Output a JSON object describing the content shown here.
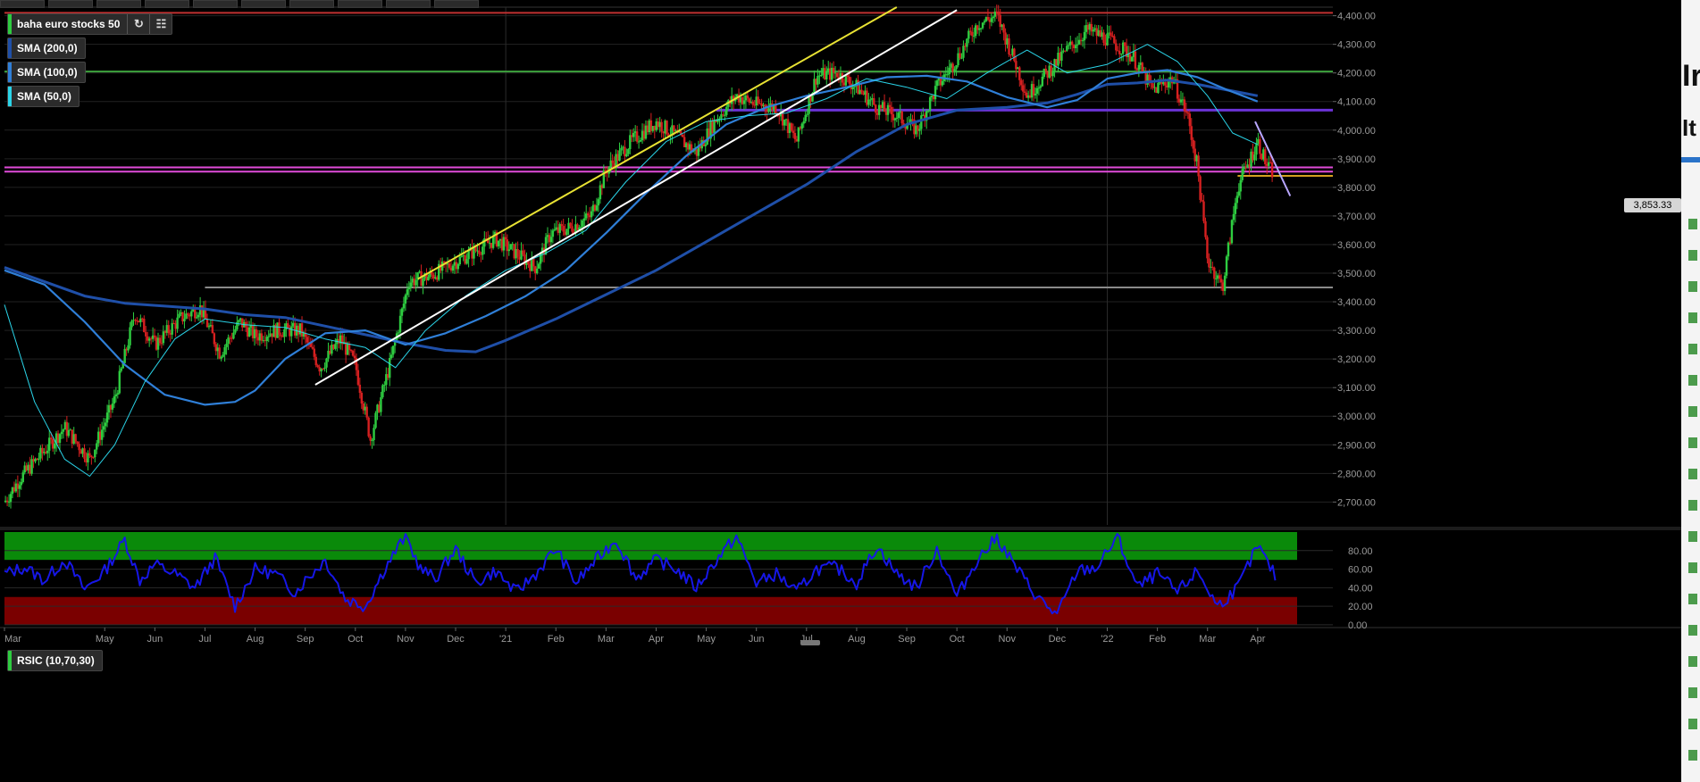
{
  "chart_data": {
    "type": "candlestick",
    "instrument": "baha euro stocks 50",
    "last_price_label": "3,853.33",
    "price_axis": {
      "ticks": [
        2700,
        2800,
        2900,
        3000,
        3100,
        3200,
        3300,
        3400,
        3500,
        3600,
        3700,
        3800,
        3900,
        4000,
        4100,
        4200,
        4300,
        4400
      ],
      "tick_labels": [
        "2,700.00",
        "2,800.00",
        "2,900.00",
        "3,000.00",
        "3,100.00",
        "3,200.00",
        "3,300.00",
        "3,400.00",
        "3,500.00",
        "3,600.00",
        "3,700.00",
        "3,800.00",
        "3,900.00",
        "4,000.00",
        "4,100.00",
        "4,200.00",
        "4,300.00",
        "4,400.00"
      ],
      "range": [
        2620,
        4430
      ]
    },
    "time_axis": {
      "labels": [
        "Mar",
        "May",
        "Jun",
        "Jul",
        "Aug",
        "Sep",
        "Oct",
        "Nov",
        "Dec",
        "'21",
        "Feb",
        "Mar",
        "Apr",
        "May",
        "Jun",
        "Jul",
        "Aug",
        "Sep",
        "Oct",
        "Nov",
        "Dec",
        "'22",
        "Feb",
        "Mar",
        "Apr"
      ],
      "label_month_index": [
        0,
        2,
        3,
        4,
        5,
        6,
        7,
        8,
        9,
        10,
        11,
        12,
        13,
        14,
        15,
        16,
        17,
        18,
        19,
        20,
        21,
        22,
        23,
        24,
        25
      ],
      "range_months": [
        0,
        26.5
      ]
    },
    "price_path": {
      "month_index": [
        0,
        0.3,
        0.8,
        1.2,
        1.7,
        2.2,
        2.6,
        3.0,
        3.5,
        3.9,
        4.3,
        4.7,
        5.0,
        5.4,
        5.9,
        6.3,
        6.7,
        7.0,
        7.3,
        7.7,
        8.0,
        8.05,
        8.5,
        9.0,
        9.4,
        9.8,
        10.2,
        10.6,
        10.9,
        11.3,
        11.7,
        12.0,
        12.5,
        13.0,
        13.4,
        13.8,
        14.2,
        14.6,
        15.0,
        15.4,
        15.8,
        16.2,
        16.6,
        17.0,
        17.4,
        17.8,
        18.2,
        18.6,
        19.0,
        19.4,
        19.8,
        20.2,
        20.4,
        20.8,
        21.2,
        21.6,
        22.0,
        22.5,
        22.9,
        23.3,
        23.6,
        23.8,
        24.0,
        24.3,
        24.6,
        24.8,
        25.0,
        25.2,
        25.3
      ],
      "close": [
        2700,
        2780,
        2880,
        2960,
        2850,
        3060,
        3360,
        3250,
        3340,
        3380,
        3220,
        3330,
        3280,
        3300,
        3300,
        3170,
        3270,
        3180,
        2920,
        3190,
        3420,
        3470,
        3490,
        3540,
        3580,
        3620,
        3570,
        3520,
        3640,
        3660,
        3700,
        3860,
        3960,
        4030,
        3980,
        3920,
        4040,
        4120,
        4090,
        4080,
        3960,
        4190,
        4200,
        4150,
        4080,
        4050,
        4000,
        4150,
        4250,
        4370,
        4400,
        4220,
        4120,
        4200,
        4280,
        4350,
        4320,
        4260,
        4140,
        4180,
        4050,
        3870,
        3550,
        3450,
        3800,
        3880,
        3960,
        3870,
        3853
      ]
    },
    "series": [
      {
        "name": "SMA (200,0)",
        "color": "#1f4fa8",
        "x": [
          0,
          0.8,
          1.6,
          2.4,
          3.2,
          4.0,
          4.8,
          5.6,
          6.4,
          7.2,
          8.0,
          8.8,
          9.4,
          10.0,
          11.0,
          12.0,
          13.0,
          14.0,
          15.0,
          16.0,
          17.0,
          18.0,
          19.0,
          20.0,
          20.8,
          21.4,
          22.0,
          22.6,
          23.2,
          23.8,
          24.4,
          25.0
        ],
        "y": [
          3520,
          3470,
          3420,
          3395,
          3385,
          3375,
          3355,
          3345,
          3315,
          3285,
          3255,
          3230,
          3225,
          3265,
          3340,
          3425,
          3510,
          3610,
          3710,
          3810,
          3925,
          4020,
          4070,
          4080,
          4095,
          4125,
          4160,
          4165,
          4175,
          4160,
          4140,
          4120
        ]
      },
      {
        "name": "SMA (100,0)",
        "color": "#2f7fd8",
        "x": [
          0,
          0.8,
          1.6,
          2.4,
          3.2,
          4.0,
          4.6,
          5.0,
          5.6,
          6.4,
          7.2,
          8.0,
          8.8,
          9.6,
          10.4,
          11.2,
          12.0,
          12.8,
          13.6,
          14.4,
          15.2,
          16.0,
          16.8,
          17.6,
          18.4,
          19.2,
          20.0,
          20.8,
          21.4,
          22.0,
          22.6,
          23.2,
          23.8,
          24.4,
          25.0
        ],
        "y": [
          3510,
          3460,
          3330,
          3180,
          3075,
          3040,
          3050,
          3090,
          3200,
          3290,
          3300,
          3250,
          3290,
          3350,
          3420,
          3510,
          3640,
          3780,
          3910,
          4020,
          4080,
          4120,
          4150,
          4185,
          4190,
          4170,
          4115,
          4080,
          4105,
          4180,
          4200,
          4210,
          4185,
          4140,
          4100
        ]
      },
      {
        "name": "SMA (50,0)",
        "color": "#2ad4e8",
        "x": [
          0,
          0.6,
          1.2,
          1.7,
          2.2,
          2.8,
          3.4,
          4.0,
          4.8,
          5.6,
          6.4,
          7.2,
          7.8,
          8.4,
          9.2,
          10.0,
          10.8,
          11.6,
          12.4,
          13.2,
          14.0,
          14.8,
          15.6,
          16.4,
          17.2,
          18.0,
          18.8,
          19.6,
          20.4,
          21.2,
          22.0,
          22.8,
          23.4,
          24.0,
          24.5,
          25.0
        ],
        "y": [
          3390,
          3050,
          2850,
          2790,
          2900,
          3120,
          3270,
          3340,
          3320,
          3310,
          3270,
          3240,
          3170,
          3300,
          3420,
          3510,
          3570,
          3650,
          3820,
          3960,
          4030,
          4050,
          4060,
          4110,
          4180,
          4150,
          4110,
          4200,
          4280,
          4200,
          4230,
          4300,
          4240,
          4120,
          3990,
          3950
        ]
      }
    ],
    "trend_lines": [
      {
        "color": "#e8e233",
        "x": [
          8.25,
          17.8
        ],
        "y": [
          3480,
          4430
        ]
      },
      {
        "color": "#ffffff",
        "x": [
          6.2,
          19.0
        ],
        "y": [
          3110,
          4420
        ]
      },
      {
        "color": "#b9a7ff",
        "x": [
          24.95,
          25.65
        ],
        "y": [
          4030,
          3770
        ]
      }
    ],
    "horizontal_lines": [
      {
        "y": 4410,
        "color": "#c03030"
      },
      {
        "y": 4205,
        "color": "#3ea33e"
      },
      {
        "y": 4070,
        "color": "#6b33d6",
        "from_month": 14.2
      },
      {
        "y": 3870,
        "color": "#e04bd9"
      },
      {
        "y": 3855,
        "color": "#e04bd9"
      },
      {
        "y": 3840,
        "color": "#d4a020",
        "from_month": 24.6
      },
      {
        "y": 3450,
        "color": "#8a8a8a",
        "from_month": 4.0
      }
    ],
    "rsi": {
      "name": "RSIC (10,70,30)",
      "color": "#1616e6",
      "overbought": 70,
      "oversold": 30,
      "ticks": [
        0,
        20,
        40,
        60,
        80
      ],
      "tick_labels": [
        "0.00",
        "20.00",
        "40.00",
        "60.00",
        "80.00"
      ],
      "range": [
        -2,
        100
      ],
      "x": [
        0,
        0.4,
        0.8,
        1.2,
        1.6,
        2.0,
        2.4,
        2.7,
        3.0,
        3.4,
        3.8,
        4.2,
        4.6,
        5.0,
        5.4,
        5.8,
        6.0,
        6.4,
        6.8,
        7.2,
        7.6,
        8.0,
        8.3,
        8.6,
        9.0,
        9.4,
        9.8,
        10.2,
        10.6,
        11.0,
        11.4,
        11.8,
        12.2,
        12.6,
        13.0,
        13.4,
        13.8,
        14.2,
        14.6,
        15.0,
        15.4,
        15.8,
        16.2,
        16.6,
        17.0,
        17.4,
        17.8,
        18.2,
        18.6,
        19.0,
        19.4,
        19.8,
        20.2,
        20.6,
        21.0,
        21.4,
        21.8,
        22.2,
        22.6,
        23.0,
        23.4,
        23.8,
        24.2,
        24.6,
        25.0,
        25.4
      ],
      "y": [
        55,
        62,
        48,
        70,
        38,
        58,
        92,
        48,
        65,
        55,
        40,
        72,
        20,
        60,
        55,
        35,
        48,
        70,
        28,
        20,
        62,
        96,
        60,
        50,
        82,
        45,
        58,
        35,
        55,
        82,
        45,
        70,
        92,
        50,
        70,
        60,
        40,
        70,
        95,
        45,
        55,
        35,
        60,
        62,
        45,
        85,
        55,
        40,
        82,
        30,
        70,
        94,
        60,
        30,
        10,
        58,
        62,
        95,
        40,
        55,
        35,
        58,
        20,
        40,
        85,
        48
      ]
    }
  },
  "ui": {
    "legend_items": [
      {
        "label": "baha euro stocks 50",
        "color": "#2ecc40"
      },
      {
        "label": "SMA (200,0)",
        "color": "#1f4fa8"
      },
      {
        "label": "SMA (100,0)",
        "color": "#2f7fd8"
      },
      {
        "label": "SMA (50,0)",
        "color": "#2ad4e8"
      }
    ],
    "rsi_legend": {
      "label": "RSIC (10,70,30)",
      "color": "#2ecc40"
    },
    "refresh_icon": "refresh-icon",
    "calendar_icon": "calendar-icon",
    "side_panel_text": [
      "Ir",
      "It"
    ],
    "colors": {
      "up": "#2ecc40",
      "down": "#d62020",
      "grid": "#222222",
      "axis_text": "#9a9a9a",
      "overbought_fill": "#0a8a0a",
      "oversold_fill": "#7a0000"
    }
  }
}
